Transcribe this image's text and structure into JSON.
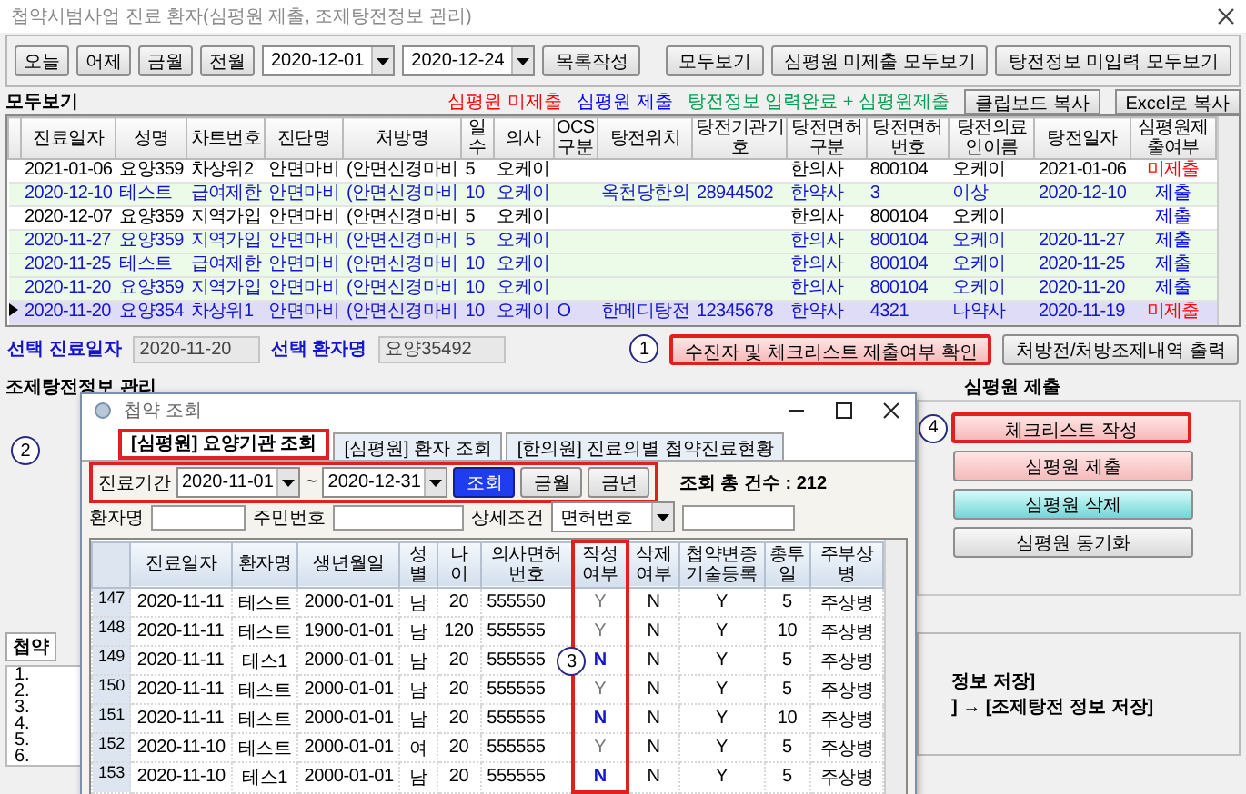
{
  "window": {
    "title": "첩약시범사업 진료 환자(심평원 제출, 조제탕전정보 관리)"
  },
  "toolbar": {
    "quick_buttons": [
      "오늘",
      "어제",
      "금월",
      "전월"
    ],
    "date_from": "2020-12-01",
    "date_to": "2020-12-24",
    "make_list": "목록작성",
    "view_buttons": [
      "모두보기",
      "심평원 미제출 모두보기",
      "탕전정보 미입력 모두보기"
    ]
  },
  "list_header": {
    "title": "모두보기",
    "legend": [
      {
        "label": "심평원 미제출",
        "color": "#ff0000"
      },
      {
        "label": "심평원 제출",
        "color": "#0000ff"
      },
      {
        "label": "탕전정보 입력완료 + 심평원제출",
        "color": "#00a050"
      }
    ],
    "copy_buttons": [
      "클립보드 복사",
      "Excel로 복사"
    ]
  },
  "table": {
    "columns": [
      "진료일자",
      "성명",
      "차트번호",
      "진단명",
      "처방명",
      "일수",
      "의사",
      "OCS구분",
      "탕전위치",
      "탕전기관기호",
      "탕전면허구분",
      "탕전면허번호",
      "탕전의료인이름",
      "탕전일자",
      "심평원제출여부"
    ],
    "rows": [
      {
        "kind": "plain",
        "selected": false,
        "submitted": false,
        "cells": [
          "2021-01-06",
          "요양359",
          "차상위2",
          "안면마비",
          "(안면신경마비",
          "5",
          "오케이",
          null,
          null,
          null,
          "한의사",
          "800104",
          "오케이",
          "2021-01-06",
          "미제출"
        ]
      },
      {
        "kind": "complete",
        "selected": false,
        "submitted": true,
        "cells": [
          "2020-12-10",
          "테스트",
          "급여제한",
          "안면마비",
          "(안면신경마비",
          "10",
          "오케이",
          null,
          "옥천당한의",
          "28944502",
          "한약사",
          "3",
          "이상",
          "2020-12-10",
          "제출"
        ]
      },
      {
        "kind": "plain",
        "selected": false,
        "submitted": true,
        "cells": [
          "2020-12-07",
          "요양359",
          "지역가입",
          "안면마비",
          "(안면신경마비",
          "5",
          "오케이",
          null,
          null,
          null,
          "한의사",
          "800104",
          "오케이",
          null,
          "제출"
        ]
      },
      {
        "kind": "complete",
        "selected": false,
        "submitted": true,
        "cells": [
          "2020-11-27",
          "요양359",
          "지역가입",
          "안면마비",
          "(안면신경마비",
          "5",
          "오케이",
          null,
          null,
          null,
          "한의사",
          "800104",
          "오케이",
          "2020-11-27",
          "제출"
        ]
      },
      {
        "kind": "complete",
        "selected": false,
        "submitted": true,
        "cells": [
          "2020-11-25",
          "테스트",
          "급여제한",
          "안면마비",
          "(안면신경마비",
          "10",
          "오케이",
          null,
          null,
          null,
          "한의사",
          "800104",
          "오케이",
          "2020-11-25",
          "제출"
        ]
      },
      {
        "kind": "complete",
        "selected": false,
        "submitted": true,
        "cells": [
          "2020-11-20",
          "요양359",
          "지역가입",
          "안면마비",
          "(안면신경마비",
          "10",
          "오케이",
          null,
          null,
          null,
          "한의사",
          "800104",
          "오케이",
          "2020-11-20",
          "제출"
        ]
      },
      {
        "kind": "entered",
        "selected": true,
        "submitted": false,
        "cells": [
          "2020-11-20",
          "요양354",
          "차상위1",
          "안면마비",
          "(안면신경마비",
          "10",
          "오케이",
          "O",
          "한메디탕전",
          "12345678",
          "한약사",
          "4321",
          "나약사",
          "2020-11-19",
          "미제출"
        ]
      }
    ]
  },
  "selection": {
    "date_label": "선택 진료일자",
    "date": "2020-11-20",
    "patient_label": "선택 환자명",
    "patient": "요양35492",
    "callout": "1",
    "check_button": {
      "label": "수진자 및 체크리스트 제출여부 확인",
      "highlighted": true
    },
    "print_button": "처방전/처방조제내역 출력"
  },
  "dispensing_panel": {
    "title": "조제탕전정보 관리",
    "tab": "첩약",
    "list_numbers": [
      "1.",
      "2.",
      "3.",
      "4.",
      "5.",
      "6."
    ]
  },
  "submit_panel": {
    "title": "심평원 제출",
    "callout": "4",
    "buttons": [
      {
        "label": "체크리스트 작성",
        "kind": "pink",
        "highlighted": true
      },
      {
        "label": "심평원 제출",
        "kind": "pink",
        "highlighted": false
      },
      {
        "label": "심평원 삭제",
        "kind": "teal",
        "highlighted": false
      },
      {
        "label": "심평원 동기화",
        "kind": "gray",
        "highlighted": false
      }
    ],
    "notes": [
      "정보 저장]",
      "] → [조제탕전 정보 저장]"
    ]
  },
  "popup": {
    "title": "첩약 조회",
    "callout": "2",
    "tabs": [
      {
        "label": "[심평원] 요양기관 조회",
        "selected": true
      },
      {
        "label": "[심평원] 환자 조회",
        "selected": false
      },
      {
        "label": "[한의원] 진료의별 첩약진료현황",
        "selected": false
      }
    ],
    "filter": {
      "period_label": "진료기간",
      "date_from": "2020-11-01",
      "separator": "~",
      "date_to": "2020-12-31",
      "search": "조회",
      "month": "금월",
      "year": "금년",
      "highlighted": true
    },
    "count": "조회 총 건수 : 212",
    "fields": {
      "patient_label": "환자명",
      "id_label": "주민번호",
      "detail_label": "상세조건",
      "detail_value": "면허번호"
    },
    "grid": {
      "columns": [
        {
          "label": "진료일자",
          "highlighted": false
        },
        {
          "label": "환자명",
          "highlighted": false
        },
        {
          "label": "생년월일",
          "highlighted": false
        },
        {
          "label": "성별",
          "highlighted": false
        },
        {
          "label": "나이",
          "highlighted": false
        },
        {
          "label": "의사면허번호",
          "highlighted": false
        },
        {
          "label": "작성여부",
          "highlighted": true
        },
        {
          "label": "삭제여부",
          "highlighted": false
        },
        {
          "label": "첩약변증기술등록",
          "highlighted": false
        },
        {
          "label": "총투일",
          "highlighted": false
        },
        {
          "label": "주부상병",
          "highlighted": false
        }
      ],
      "rows": [
        {
          "no": "147",
          "written": true,
          "cells": [
            "2020-11-11",
            "테스트",
            "2000-01-01",
            "남",
            "20",
            "555550",
            "Y",
            "N",
            "Y",
            "5",
            "주상병"
          ]
        },
        {
          "no": "148",
          "written": true,
          "cells": [
            "2020-11-11",
            "테스트",
            "1900-01-01",
            "남",
            "120",
            "555555",
            "Y",
            "N",
            "Y",
            "10",
            "주상병"
          ]
        },
        {
          "no": "149",
          "written": false,
          "callout": "3",
          "cells": [
            "2020-11-11",
            "테스1",
            "2000-01-01",
            "남",
            "20",
            "555555",
            "N",
            "N",
            "Y",
            "5",
            "주상병"
          ]
        },
        {
          "no": "150",
          "written": true,
          "cells": [
            "2020-11-11",
            "테스트",
            "2000-01-01",
            "남",
            "20",
            "555555",
            "Y",
            "N",
            "Y",
            "5",
            "주상병"
          ]
        },
        {
          "no": "151",
          "written": false,
          "cells": [
            "2020-11-11",
            "테스트",
            "2000-01-01",
            "남",
            "20",
            "555555",
            "N",
            "N",
            "Y",
            "10",
            "주상병"
          ]
        },
        {
          "no": "152",
          "written": true,
          "cells": [
            "2020-11-10",
            "테스트",
            "2000-01-01",
            "여",
            "20",
            "555555",
            "Y",
            "N",
            "Y",
            "5",
            "주상병"
          ]
        },
        {
          "no": "153",
          "written": false,
          "cells": [
            "2020-11-10",
            "테스1",
            "2000-01-01",
            "남",
            "20",
            "555555",
            "N",
            "N",
            "Y",
            "5",
            "주상병"
          ]
        }
      ]
    }
  }
}
